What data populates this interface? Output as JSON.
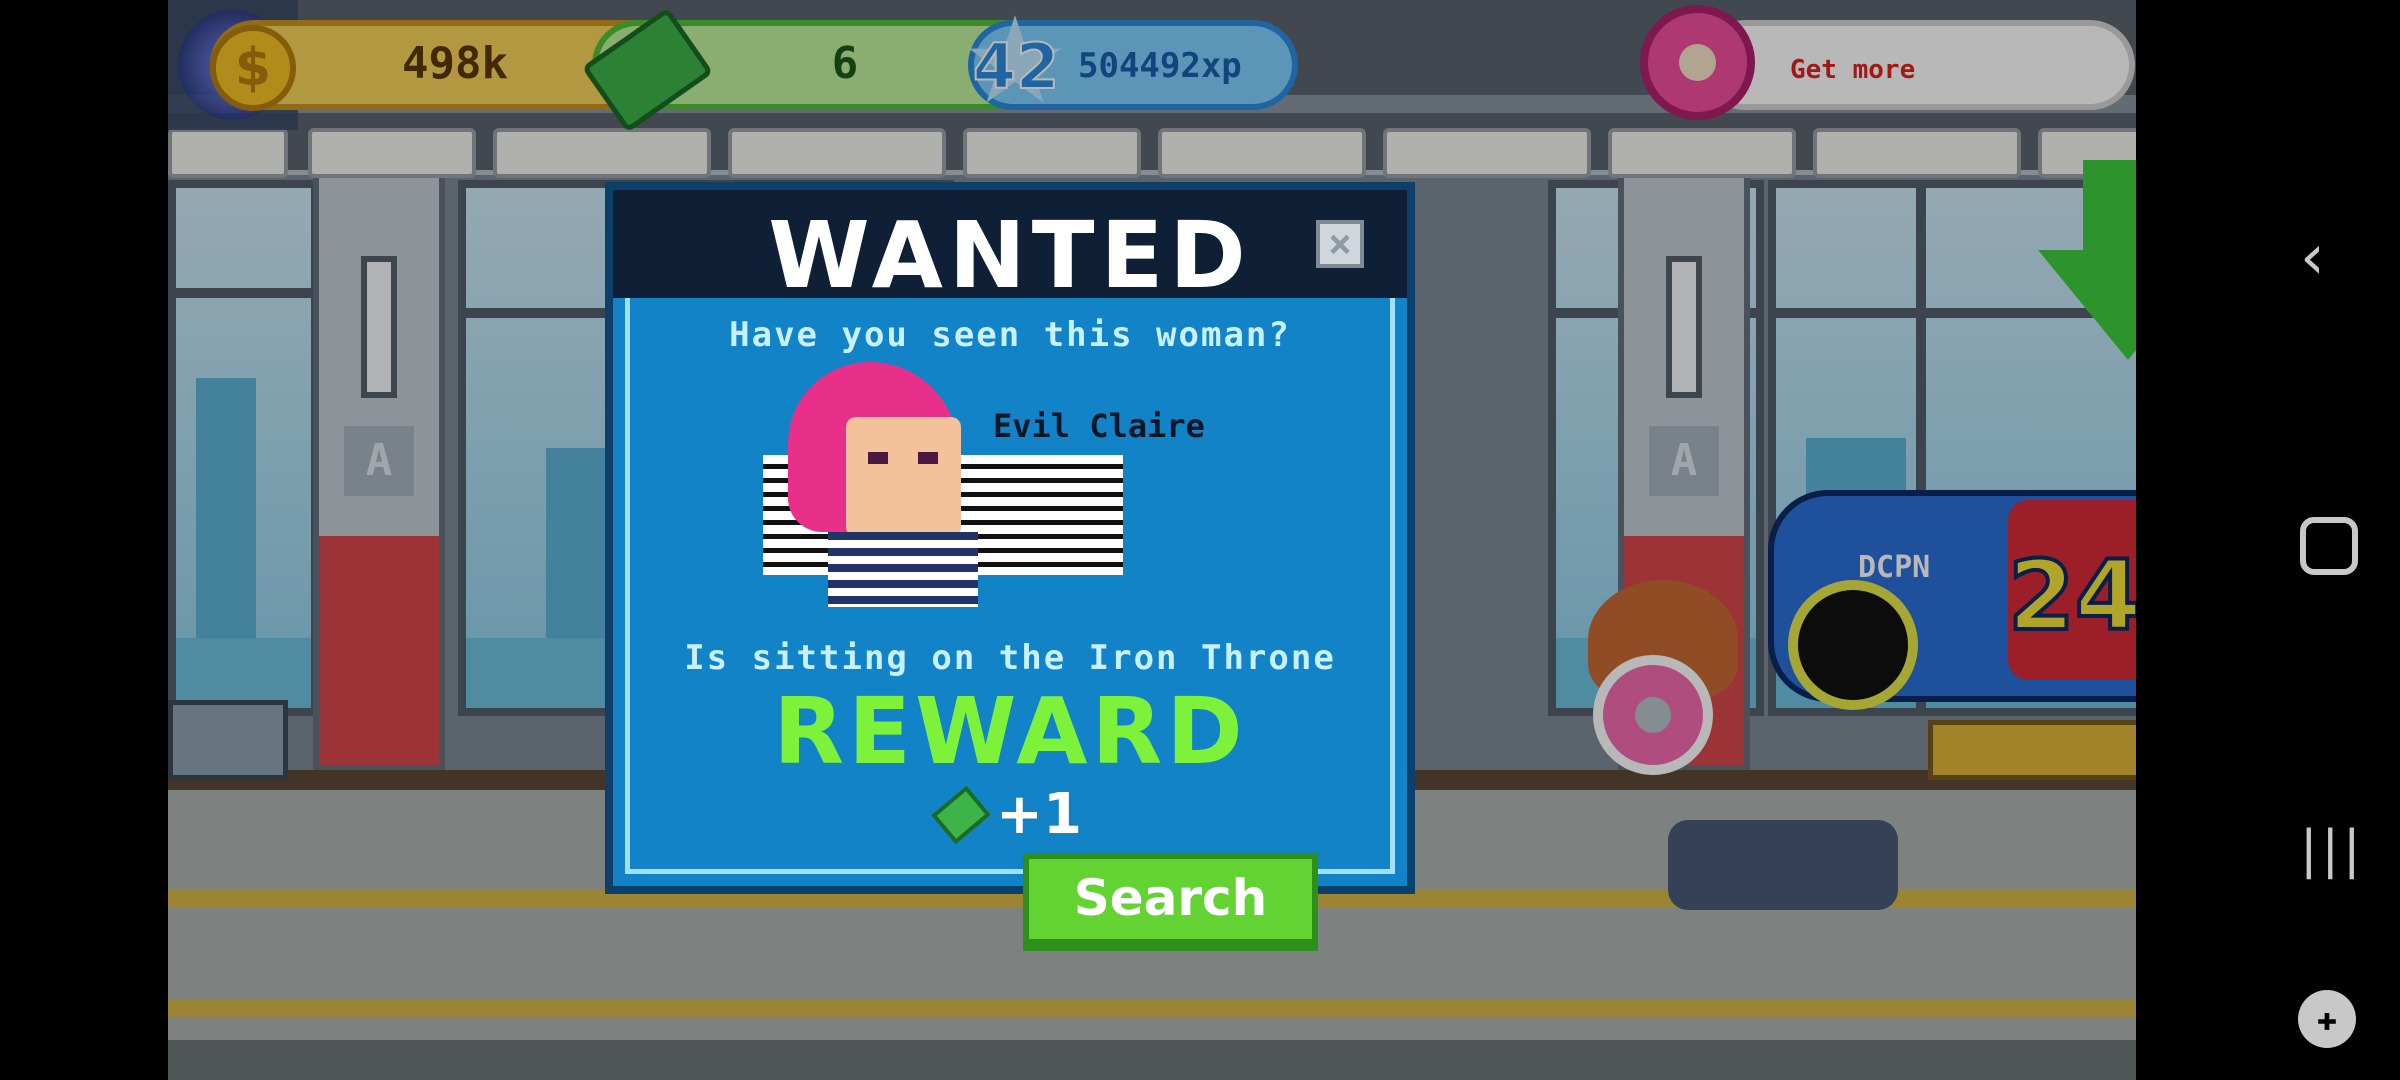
{
  "hud": {
    "coins": "498k",
    "coins_plus": "+",
    "coin_symbol": "$",
    "cash": "6",
    "cash_plus": "+",
    "level": "42",
    "xp": "504492xp",
    "get_more": "Get more"
  },
  "modal": {
    "title": "WANTED",
    "close_glyph": "×",
    "question": "Have you seen this woman?",
    "suspect_name": "Evil Claire",
    "location": "Is sitting on the Iron Throne",
    "reward_title": "REWARD",
    "reward_amount": "+1",
    "search_label": "Search"
  },
  "colors": {
    "modal_bg": "#1383c8",
    "reward_green": "#7ef23a",
    "search_green": "#63d233"
  },
  "icons": {
    "coin": "coin-icon",
    "cash": "cash-icon",
    "xp": "level-star-icon",
    "donut": "donut-icon",
    "close": "close-icon",
    "back": "back-icon",
    "home": "home-icon",
    "recents": "recents-icon",
    "game_tools": "gamepad-icon"
  }
}
